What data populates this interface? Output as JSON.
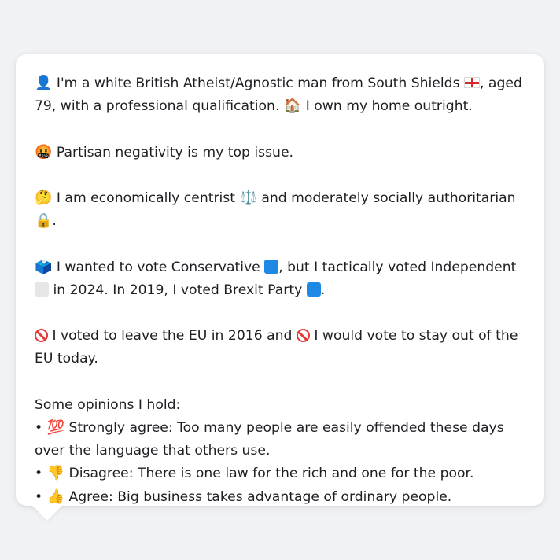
{
  "profile": {
    "p1": {
      "icon": "bust-in-silhouette",
      "text_a": " I'm a white British Atheist/Agnostic man from South Shields ",
      "flag": "england-flag",
      "text_b": ", aged 79, with a professional qualification. ",
      "home_icon": "house",
      "text_c": " I own my home outright."
    },
    "p2": {
      "icon": "face-with-symbols-on-mouth",
      "text": " Partisan negativity is my top issue."
    },
    "p3": {
      "icon": "thinking-face",
      "text_a": " I am economically centrist ",
      "scales_icon": "balance-scale",
      "text_b": " and moderately socially authoritarian ",
      "lock_icon": "lock",
      "text_c": "."
    },
    "p4": {
      "icon": "ballot-box",
      "text_a": " I wanted to vote Conservative ",
      "conservative_color": "#1e88e5",
      "text_b": ", but I tactically voted Independent ",
      "independent_color": "#e6e6e6",
      "text_c": " in 2024. In 2019, I voted Brexit Party ",
      "brexit_color": "#1e88e5",
      "text_d": "."
    },
    "p5": {
      "icon1": "no-entry-sign",
      "text_a": " I voted to leave the EU in 2016 and ",
      "icon2": "no-entry-sign",
      "text_b": " I would vote to stay out of the EU today."
    },
    "opinions": {
      "heading": "Some opinions I hold:",
      "items": [
        {
          "bullet": "•",
          "icon": "hundred-points",
          "text": " Strongly agree: Too many people are easily offended these days over the language that others use."
        },
        {
          "bullet": "•",
          "icon": "thumbs-down",
          "text": " Disagree: There is one law for the rich and one for the poor."
        },
        {
          "bullet": "•",
          "icon": "thumbs-up",
          "text": " Agree: Big business takes advantage of ordinary people."
        }
      ]
    }
  }
}
